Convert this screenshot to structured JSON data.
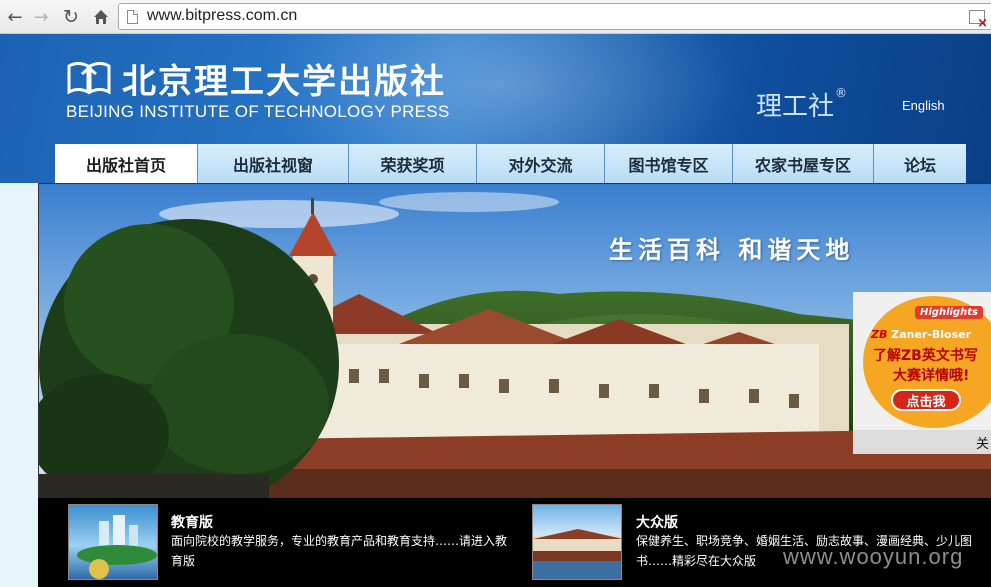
{
  "browser": {
    "url": "www.bitpress.com.cn",
    "icons": [
      "back-arrow-icon",
      "forward-arrow-icon",
      "reload-icon",
      "home-icon",
      "page-icon",
      "blocked-plugin-icon"
    ]
  },
  "header": {
    "title_cn": "北京理工大学出版社",
    "title_en": "BEIJING INSTITUTE OF TECHNOLOGY PRESS",
    "brand": "理工社",
    "brand_mark": "®",
    "language_link": "English",
    "colors": {
      "primary": "#1d62b2",
      "dark": "#0a3f86"
    }
  },
  "menu": {
    "items": [
      {
        "label": "出版社首页",
        "active": true
      },
      {
        "label": "出版社视窗",
        "active": false
      },
      {
        "label": "荣获奖项",
        "active": false
      },
      {
        "label": "对外交流",
        "active": false
      },
      {
        "label": "图书馆专区",
        "active": false
      },
      {
        "label": "农家书屋专区",
        "active": false
      },
      {
        "label": "论坛",
        "active": false
      }
    ]
  },
  "banner": {
    "slogan": "生活百科 和谐天地"
  },
  "ad": {
    "highlights": "Highlights",
    "zb_mark": "ZB",
    "zb_name": "Zaner-Bloser",
    "line1": "了解ZB英文书写",
    "line2": "大赛详情哦!",
    "button": "点击我",
    "close": "关"
  },
  "sections": [
    {
      "title": "教育版",
      "description": "面向院校的教学服务，专业的教育产品和教育支持……请进入教育版"
    },
    {
      "title": "大众版",
      "description": "保健养生、职场竞争、婚姻生活、励志故事、漫画经典、少儿图书……精彩尽在大众版"
    }
  ],
  "watermark": "www.wooyun.org"
}
